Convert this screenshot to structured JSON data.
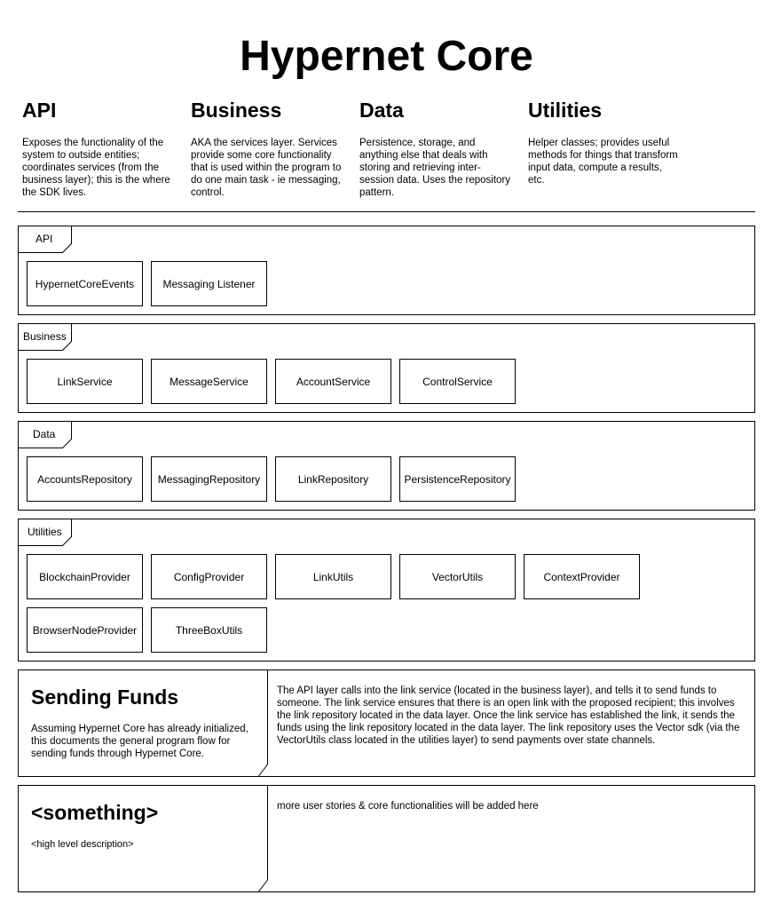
{
  "title": "Hypernet Core",
  "columns": [
    {
      "heading": "API",
      "description": "Exposes the functionality of the system to outside entities; coordinates services (from the business layer); this is the where the SDK lives."
    },
    {
      "heading": "Business",
      "description": "AKA the services layer. Services provide some core functionality that is used within the program to do one main task - ie messaging, control."
    },
    {
      "heading": "Data",
      "description": "Persistence, storage, and anything else that deals with storing and retrieving inter-session data. Uses the repository pattern."
    },
    {
      "heading": "Utilities",
      "description": "Helper classes; provides useful methods for things that transform input data, compute a results, etc."
    }
  ],
  "layers": [
    {
      "label": "API",
      "components": [
        "HypernetCoreEvents",
        "Messaging Listener"
      ]
    },
    {
      "label": "Business",
      "components": [
        "LinkService",
        "MessageService",
        "AccountService",
        "ControlService"
      ]
    },
    {
      "label": "Data",
      "components": [
        "AccountsRepository",
        "MessagingRepository",
        "LinkRepository",
        "PersistenceRepository"
      ]
    },
    {
      "label": "Utilities",
      "components": [
        "BlockchainProvider",
        "ConfigProvider",
        "LinkUtils",
        "VectorUtils",
        "ContextProvider",
        "BrowserNodeProvider",
        "ThreeBoxUtils"
      ]
    }
  ],
  "stories": [
    {
      "title": "Sending Funds",
      "summary": "Assuming Hypernet Core has already initialized, this documents the general program flow for sending funds through Hypernet Core.",
      "detail": "The API layer calls into the link service (located in the business layer), and tells it to send funds to someone. The link service ensures that there is an open link with the proposed recipient; this involves the link repository located in the data layer. Once the link service has established the link, it sends the funds using the link repository located in the data layer. The link repository uses the Vector sdk (via the VectorUtils class located in the utilities layer) to send payments over state channels."
    },
    {
      "title": "<something>",
      "summary": "<high level description>",
      "detail": "more user stories & core functionalities will be added here"
    }
  ]
}
